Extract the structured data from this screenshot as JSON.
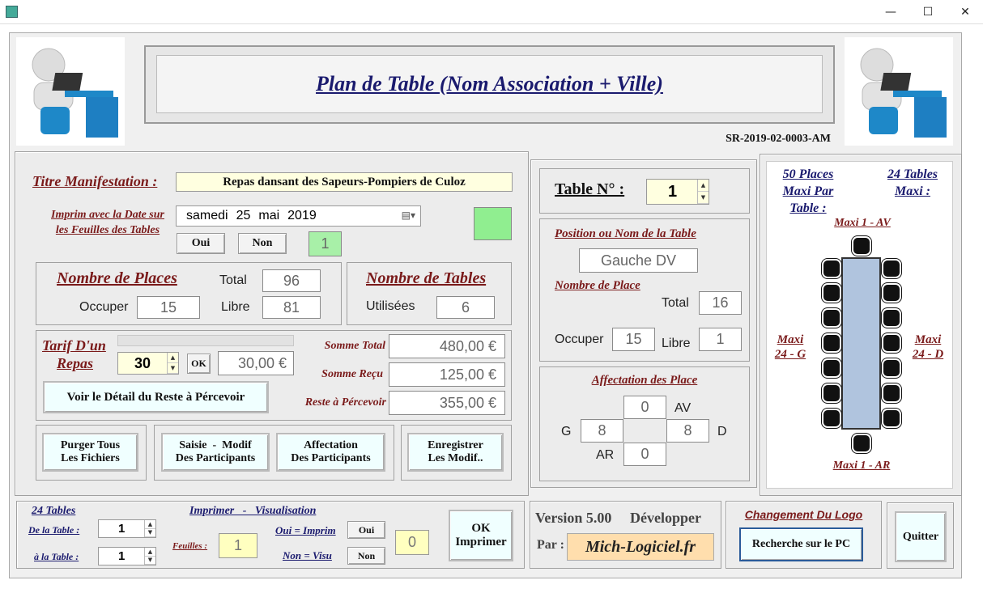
{
  "window": {
    "minimize": "—",
    "maximize": "☐",
    "close": "✕"
  },
  "header": {
    "title": "Plan de Table (Nom Association + Ville)",
    "code": "SR-2019-02-0003-AM"
  },
  "manifestation": {
    "label": "Titre Manifestation :",
    "value": "Repas dansant des Sapeurs-Pompiers de Culoz",
    "date_label": "Imprim avec la Date sur les Feuilles des Tables",
    "date_day": "samedi",
    "date_num": "25",
    "date_month": "mai",
    "date_year": "2019",
    "oui": "Oui",
    "non": "Non",
    "flag": "1"
  },
  "places": {
    "label": "Nombre de Places",
    "total_label": "Total",
    "total": "96",
    "occuper_label": "Occuper",
    "occuper": "15",
    "libre_label": "Libre",
    "libre": "81"
  },
  "tables": {
    "label": "Nombre de Tables",
    "utilisees_label": "Utilisées",
    "utilisees": "6"
  },
  "tarif": {
    "label_line1": "Tarif D'un",
    "label_line2": "Repas",
    "value": "30",
    "ok": "OK",
    "amount": "30,00 €",
    "somme_total_label": "Somme Total",
    "somme_total": "480,00 €",
    "somme_recu_label": "Somme Reçu",
    "somme_recu": "125,00 €",
    "reste_label": "Reste à Pércevoir",
    "reste": "355,00 €",
    "detail_button": "Voir le Détail du Reste à Pércevoir"
  },
  "actions": {
    "purger_1": "Purger Tous",
    "purger_2": "Les Fichiers",
    "saisie_1": "Saisie  -  Modif",
    "saisie_2": "Des Participants",
    "affect_1": "Affectation",
    "affect_2": "Des Participants",
    "enreg_1": "Enregistrer",
    "enreg_2": "Les Modif.."
  },
  "table_panel": {
    "label": "Table N° :",
    "number": "1",
    "position_label": "Position ou Nom de la Table",
    "position": "Gauche DV",
    "nb_place_label": "Nombre de Place",
    "total_label": "Total",
    "total": "16",
    "occuper_label": "Occuper",
    "occuper": "15",
    "libre_label": "Libre",
    "libre": "1",
    "affect_label": "Affectation des Place",
    "av_label": "AV",
    "av": "0",
    "g_label": "G",
    "g": "8",
    "d_label": "D",
    "d": "8",
    "ar_label": "AR",
    "ar": "0"
  },
  "diagram": {
    "places_1": "50 Places",
    "places_2": "Maxi Par",
    "places_3": "Table  :",
    "tables_1": "24 Tables",
    "tables_2": "Maxi :",
    "maxi_av": "Maxi  1 - AV",
    "maxi_g_1": "Maxi",
    "maxi_g_2": "24 - G",
    "maxi_d_1": "Maxi",
    "maxi_d_2": "24 - D",
    "maxi_ar": "Maxi 1 - AR"
  },
  "print": {
    "tables_label": "24 Tables",
    "title": "Imprimer   -   Visualisation",
    "de_label": "De la Table :",
    "de": "1",
    "a_label": "à la Table :",
    "a": "1",
    "feuilles_label": "Feuilles :",
    "feuilles": "1",
    "oui_label": "Oui = Imprim",
    "oui": "Oui",
    "non_label": "Non = Visu",
    "non": "Non",
    "count": "0",
    "ok_1": "OK",
    "ok_2": "Imprimer"
  },
  "version": {
    "text": "Version 5.00",
    "dev": "Développer",
    "par_label": "Par :",
    "author": "Mich-Logiciel.fr"
  },
  "logo": {
    "label": "Changement Du Logo",
    "button": "Recherche sur le PC"
  },
  "quit": "Quitter"
}
